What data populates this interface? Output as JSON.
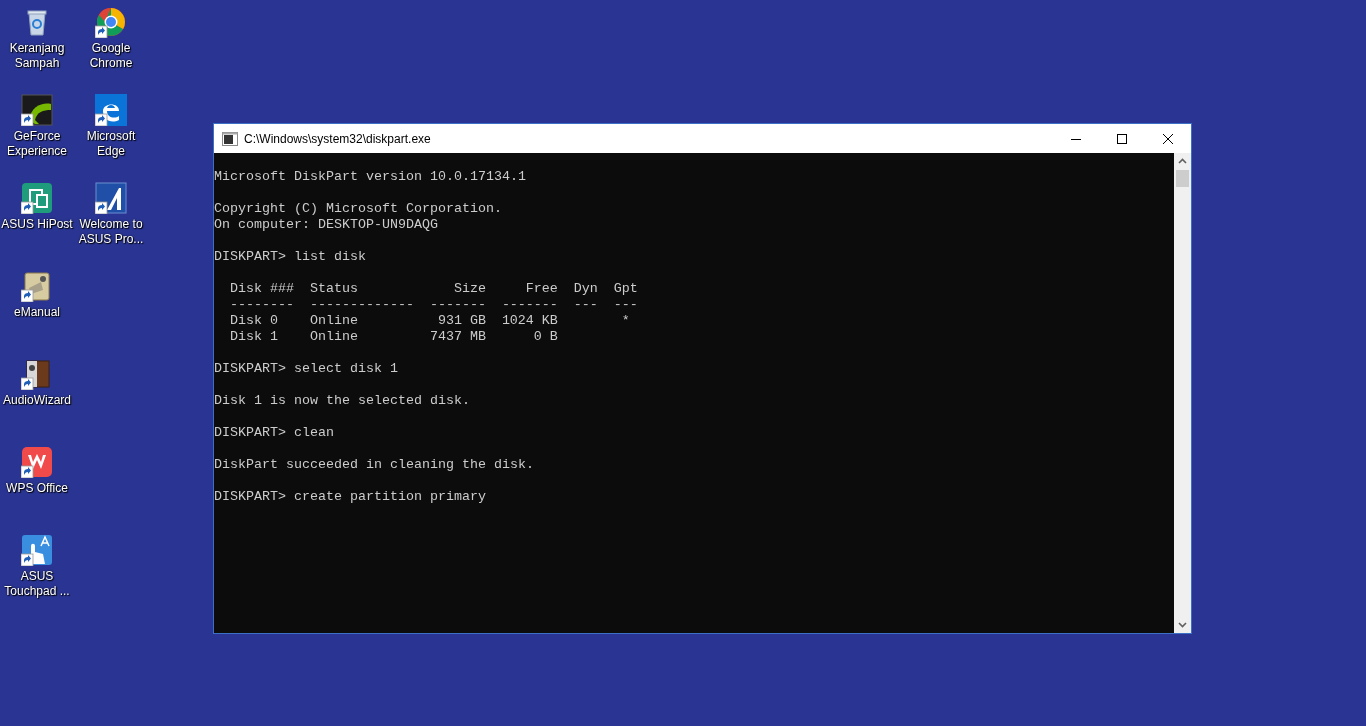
{
  "desktop": {
    "columns": [
      [
        {
          "label": "Keranjang Sampah",
          "kind": "bin",
          "shortcut": false
        },
        {
          "label": "GeForce Experience",
          "kind": "geforce",
          "shortcut": true
        },
        {
          "label": "ASUS HiPost",
          "kind": "hipost",
          "shortcut": true
        },
        {
          "label": "eManual",
          "kind": "manual",
          "shortcut": true
        },
        {
          "label": "AudioWizard",
          "kind": "audio",
          "shortcut": true
        },
        {
          "label": "WPS Office",
          "kind": "wps",
          "shortcut": true
        },
        {
          "label": "ASUS Touchpad ...",
          "kind": "touchpad",
          "shortcut": true
        }
      ],
      [
        {
          "label": "Google Chrome",
          "kind": "chrome",
          "shortcut": true
        },
        {
          "label": "Microsoft Edge",
          "kind": "edge",
          "shortcut": true
        },
        {
          "label": "Welcome to ASUS Pro...",
          "kind": "asus",
          "shortcut": true
        }
      ]
    ]
  },
  "window": {
    "title": "C:\\Windows\\system32\\diskpart.exe",
    "console": [
      {
        "kind": "gap"
      },
      {
        "kind": "text",
        "text": "Microsoft DiskPart version 10.0.17134.1"
      },
      {
        "kind": "gap"
      },
      {
        "kind": "text",
        "text": "Copyright (C) Microsoft Corporation."
      },
      {
        "kind": "text",
        "text": "On computer: DESKTOP-UN9DAQG"
      },
      {
        "kind": "gap"
      },
      {
        "kind": "text",
        "text": "DISKPART> list disk"
      },
      {
        "kind": "gap"
      },
      {
        "kind": "table",
        "columns": [
          "Disk ###",
          "Status",
          "Size",
          "Free",
          "Dyn",
          "Gpt"
        ],
        "separator": [
          "--------",
          "-------------",
          "-------",
          "-------",
          "---",
          "---"
        ],
        "rows": [
          [
            "Disk 0",
            "Online",
            "931 GB",
            "1024 KB",
            "",
            "*"
          ],
          [
            "Disk 1",
            "Online",
            "7437 MB",
            "0 B",
            "",
            ""
          ]
        ]
      },
      {
        "kind": "gap"
      },
      {
        "kind": "text",
        "text": "DISKPART> select disk 1"
      },
      {
        "kind": "gap"
      },
      {
        "kind": "text",
        "text": "Disk 1 is now the selected disk."
      },
      {
        "kind": "gap"
      },
      {
        "kind": "text",
        "text": "DISKPART> clean"
      },
      {
        "kind": "gap"
      },
      {
        "kind": "text",
        "text": "DiskPart succeeded in cleaning the disk."
      },
      {
        "kind": "gap"
      },
      {
        "kind": "text",
        "text": "DISKPART> create partition primary"
      }
    ]
  }
}
